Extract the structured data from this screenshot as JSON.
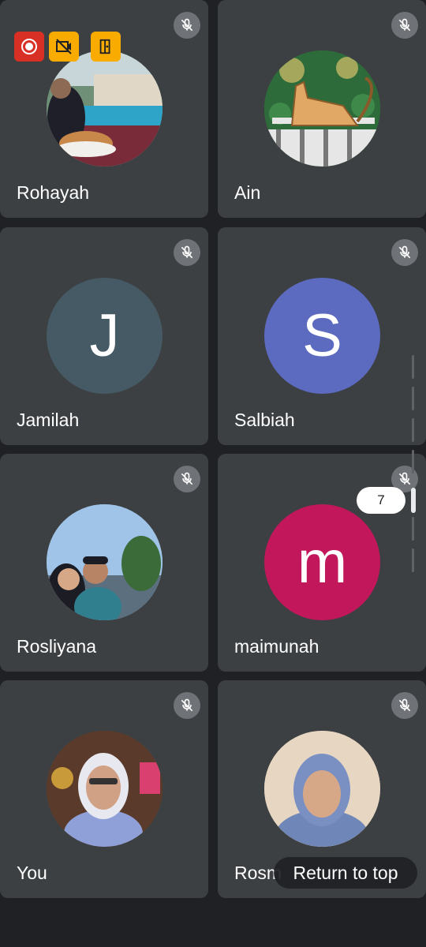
{
  "participants": [
    {
      "name": "Rohayah",
      "avatar_type": "photo",
      "muted": true
    },
    {
      "name": "Ain",
      "avatar_type": "illustration",
      "muted": true
    },
    {
      "name": "Jamilah",
      "avatar_type": "initial",
      "initial": "J",
      "color": "#455a64",
      "muted": true
    },
    {
      "name": "Salbiah",
      "avatar_type": "initial",
      "initial": "S",
      "color": "#5c6bc0",
      "muted": true
    },
    {
      "name": "Rosliyana",
      "avatar_type": "photo",
      "muted": true
    },
    {
      "name": "maimunah",
      "avatar_type": "initial",
      "initial": "m",
      "color": "#c2185b",
      "muted": true
    },
    {
      "name": "You",
      "avatar_type": "photo",
      "muted": true
    },
    {
      "name": "Rosm",
      "avatar_type": "photo",
      "muted": true
    }
  ],
  "status_icons": [
    {
      "icon": "recording-icon",
      "color": "#d93025"
    },
    {
      "icon": "no-camera-icon",
      "color": "#f9ab00"
    },
    {
      "icon": "exit-door-icon",
      "color": "#f9ab00"
    }
  ],
  "page_indicator": "7",
  "return_to_top_label": "Return to top",
  "colors": {
    "background": "#202124",
    "tile": "#3c4043",
    "mute_badge": "#6f7276"
  }
}
